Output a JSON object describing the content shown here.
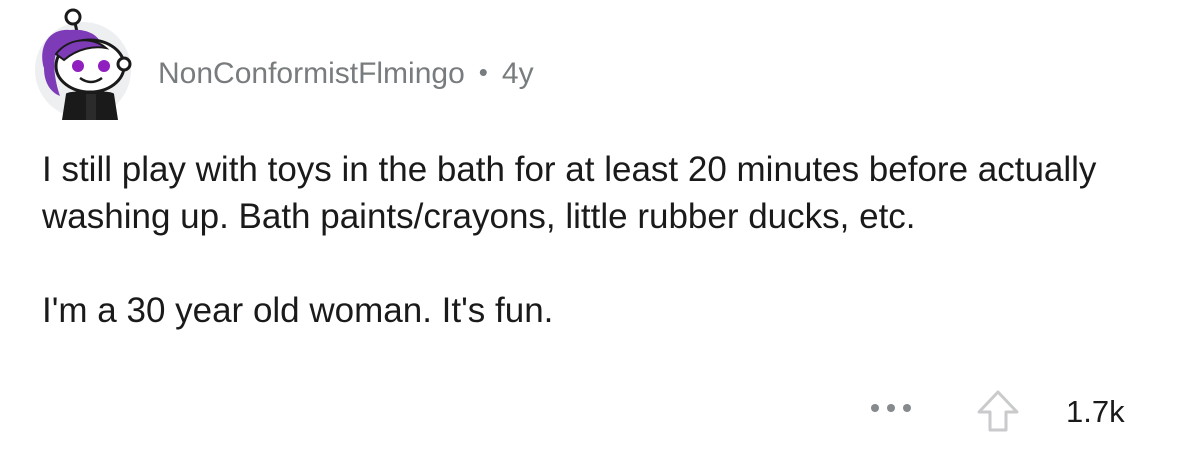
{
  "comment": {
    "author": "NonConformistFlmingo",
    "separator": "•",
    "age": "4y",
    "paragraphs": [
      "I still play with toys in the bath for at least 20 minutes before actually washing up. Bath paints/crayons, little rubber ducks, etc.",
      "I'm a 30 year old woman. It's fun."
    ],
    "score": "1.7k"
  },
  "icons": {
    "avatar": "snoo-avatar-icon",
    "more": "more-options-icon",
    "upvote": "upvote-arrow-icon"
  },
  "colors": {
    "text_primary": "#1a1a1b",
    "text_meta": "#787c7e",
    "avatar_bg": "#edeff1",
    "avatar_hair": "#7e3bb8",
    "icon_gray": "#878a8c"
  }
}
